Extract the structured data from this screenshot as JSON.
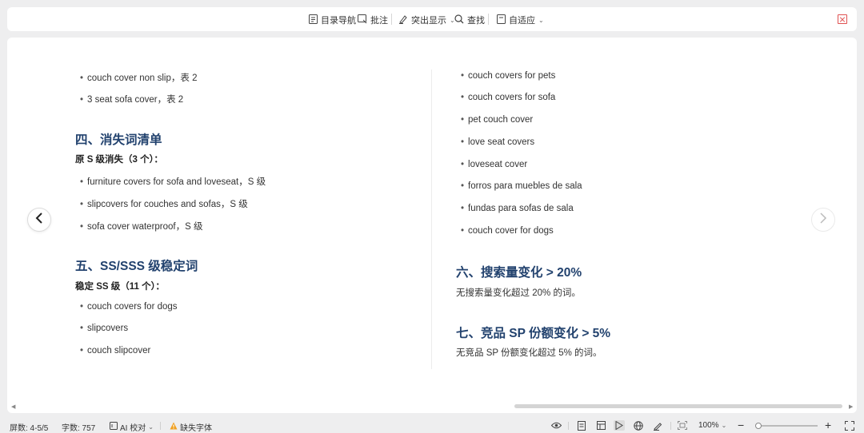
{
  "toolbar": {
    "toc_nav": "目录导航",
    "annotate": "批注",
    "highlight": "突出显示",
    "find": "查找",
    "fit": "自适应"
  },
  "left_column": {
    "items_top": [
      "couch cover non slip，表 2",
      "3 seat sofa cover，表 2"
    ],
    "section4": {
      "title": "四、消失词清单",
      "subtitle": "原 S 级消失（3 个）：",
      "items": [
        "furniture covers for sofa and loveseat，S 级",
        "slipcovers for couches and sofas，S 级",
        "sofa cover waterproof，S 级"
      ]
    },
    "section5": {
      "title": "五、SS/SSS 级稳定词",
      "subtitle": "稳定 SS 级（11 个）：",
      "items": [
        "couch covers for dogs",
        "slipcovers",
        "couch slipcover"
      ]
    }
  },
  "right_column": {
    "items_top": [
      "couch covers for pets",
      "couch covers for sofa",
      "pet couch cover",
      "love seat covers",
      "loveseat cover",
      "forros para muebles de sala",
      "fundas para sofas de sala",
      "couch cover for dogs"
    ],
    "section6": {
      "title": "六、搜索量变化 > 20%",
      "text": "无搜索量变化超过 20% 的词。"
    },
    "section7": {
      "title": "七、竞品 SP 份额变化 > 5%",
      "text": "无竞品 SP 份额变化超过 5% 的词。"
    }
  },
  "statusbar": {
    "screens": "屏数: 4-5/5",
    "word_count": "字数: 757",
    "ai_check": "AI 校对",
    "missing_font": "缺失字体",
    "zoom": "100%"
  },
  "colors": {
    "heading": "#22426e",
    "warning": "#f0a020",
    "close": "#e05050"
  }
}
